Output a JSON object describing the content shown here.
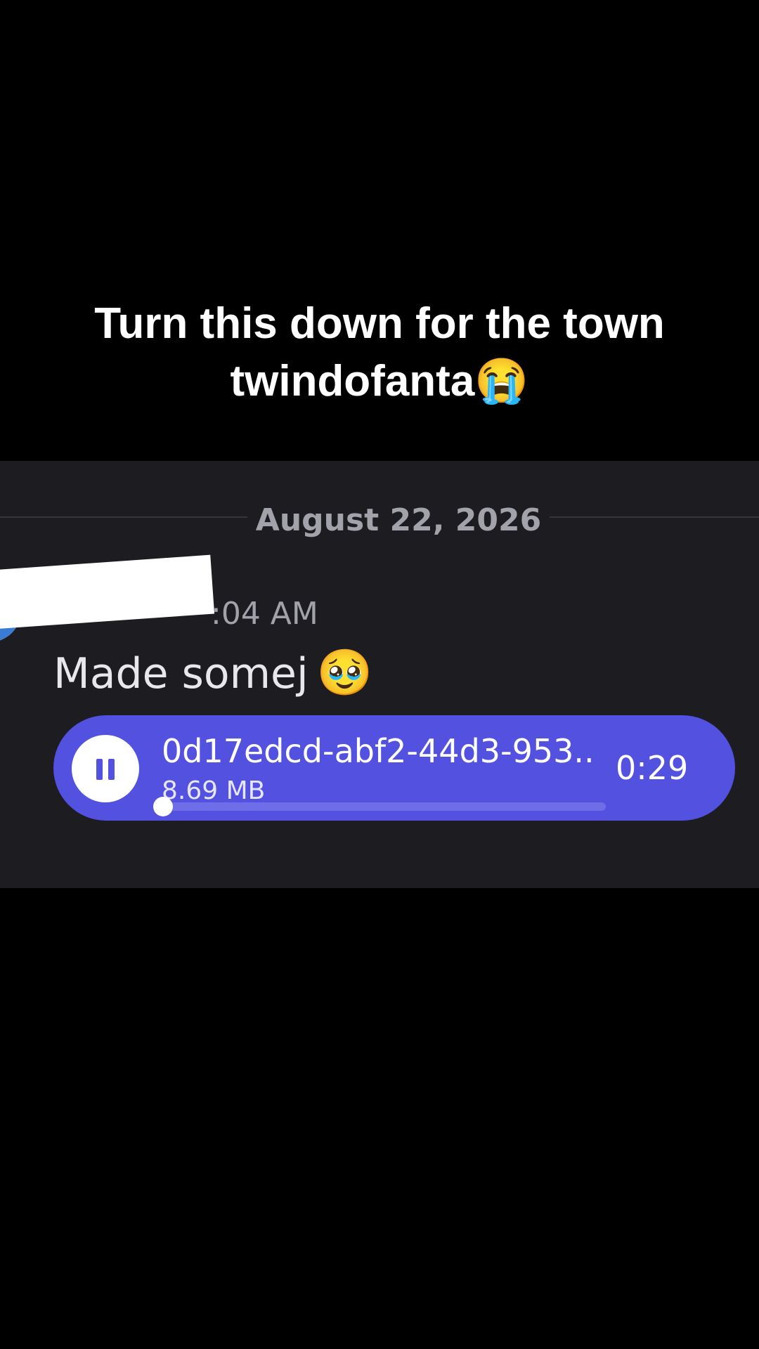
{
  "caption": {
    "line1": "Turn this down for the town",
    "line2": "twindofanta😭"
  },
  "chat": {
    "date_divider": "August 22, 2026",
    "timestamp": ":04 AM",
    "message_text": "Made somej",
    "message_emoji": "🥹",
    "audio": {
      "file_name": "0d17edcd-abf2-44d3-953...",
      "file_size": "8.69 MB",
      "duration": "0:29",
      "progress": 0.0,
      "state": "playing",
      "control_icon": "pause-icon"
    }
  },
  "colors": {
    "page_background": "#000000",
    "chat_background": "#1c1c21",
    "audio_card": "#5351e0",
    "muted_text": "#a2a2aa"
  }
}
